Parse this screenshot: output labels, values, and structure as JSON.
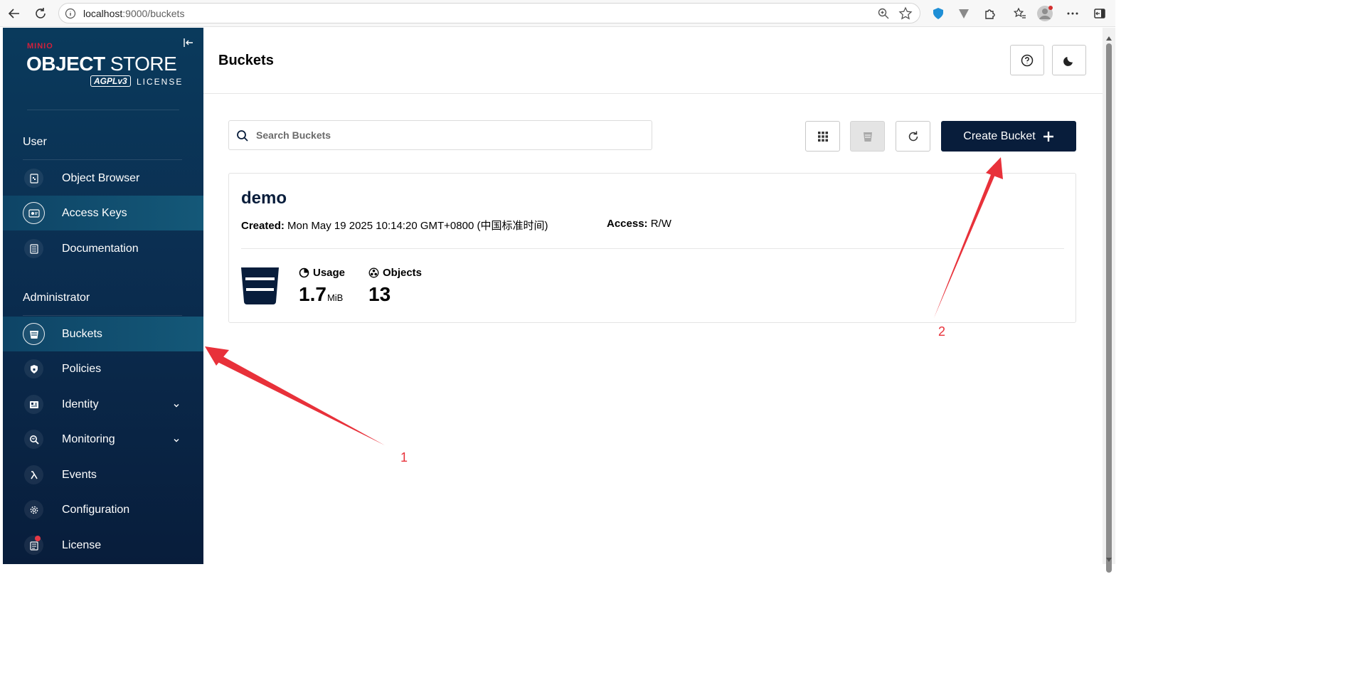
{
  "browser": {
    "url_host": "localhost",
    "url_path": ":9000/buckets"
  },
  "sidebar": {
    "logo": {
      "brand": "MINIO",
      "product_bold": "OBJECT",
      "product_thin": "STORE",
      "license_badge": "AGPLv3",
      "license_text": "LICENSE"
    },
    "sections": [
      {
        "title": "User",
        "items": [
          {
            "label": "Object Browser",
            "icon": "object-browser-icon"
          },
          {
            "label": "Access Keys",
            "icon": "access-keys-icon",
            "active": true
          },
          {
            "label": "Documentation",
            "icon": "documentation-icon"
          }
        ]
      },
      {
        "title": "Administrator",
        "items": [
          {
            "label": "Buckets",
            "icon": "bucket-icon",
            "active": true
          },
          {
            "label": "Policies",
            "icon": "shield-icon"
          },
          {
            "label": "Identity",
            "icon": "id-card-icon",
            "expandable": true
          },
          {
            "label": "Monitoring",
            "icon": "monitoring-icon",
            "expandable": true
          },
          {
            "label": "Events",
            "icon": "lambda-icon"
          },
          {
            "label": "Configuration",
            "icon": "gear-icon"
          },
          {
            "label": "License",
            "icon": "license-icon",
            "badge": true
          }
        ]
      }
    ]
  },
  "main": {
    "title": "Buckets",
    "search": {
      "placeholder": "Search Buckets",
      "value": ""
    },
    "create_button": "Create Bucket",
    "buckets": [
      {
        "name": "demo",
        "created_label": "Created:",
        "created_value": "Mon May 19 2025 10:14:20 GMT+0800 (中国标准时间)",
        "access_label": "Access:",
        "access_value": "R/W",
        "usage_label": "Usage",
        "usage_value": "1.7",
        "usage_unit": "MiB",
        "objects_label": "Objects",
        "objects_value": "13"
      }
    ]
  },
  "annotations": [
    "1",
    "2"
  ],
  "colors": {
    "sidebar_dark": "#081d3b",
    "sidebar_light": "#0a3a5c",
    "primary": "#081d3b",
    "brand_red": "#d1203b",
    "annotation_red": "#e8313a"
  }
}
